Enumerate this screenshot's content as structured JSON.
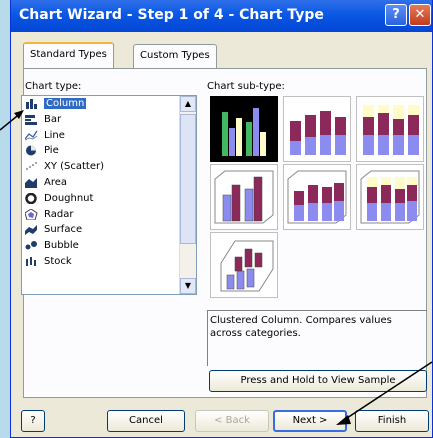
{
  "window": {
    "title": "Chart Wizard - Step 1 of 4 - Chart Type",
    "help_glyph": "?",
    "close_glyph": "✕"
  },
  "tabs": [
    {
      "label": "Standard Types"
    },
    {
      "label": "Custom Types"
    }
  ],
  "chart_type": {
    "label": "Chart type:",
    "items": [
      "Column",
      "Bar",
      "Line",
      "Pie",
      "XY (Scatter)",
      "Area",
      "Doughnut",
      "Radar",
      "Surface",
      "Bubble",
      "Stock"
    ],
    "selected": "Column"
  },
  "chart_subtype": {
    "label": "Chart sub-type:",
    "selected_index": 0
  },
  "description": "Clustered Column. Compares values across categories.",
  "buttons": {
    "sample": "Press and Hold to View Sample",
    "help": "?",
    "cancel": "Cancel",
    "back": "< Back",
    "next": "Next >",
    "finish": "Finish"
  },
  "colors": {
    "titlebar": "#0a58e3",
    "selection": "#316ac5",
    "bar_purple": "#8b2a5a",
    "bar_blue": "#8c8cf0",
    "bar_cream": "#fffcc8",
    "bar_green": "#43b862",
    "arrow": "#000000"
  }
}
